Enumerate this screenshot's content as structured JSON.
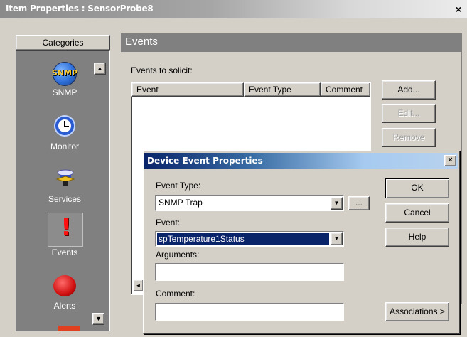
{
  "window": {
    "title": "Item Properties : SensorProbe8",
    "close_glyph": "×"
  },
  "categories": {
    "header": "Categories",
    "items": [
      {
        "label": "SNMP",
        "icon": "snmp-icon",
        "icon_text": "SNMP"
      },
      {
        "label": "Monitor",
        "icon": "monitor-clock-icon"
      },
      {
        "label": "Services",
        "icon": "services-icon"
      },
      {
        "label": "Events",
        "icon": "events-exclamation-icon",
        "selected": true
      },
      {
        "label": "Alerts",
        "icon": "alerts-icon"
      }
    ],
    "scroll_up_glyph": "▲",
    "scroll_down_glyph": "▼"
  },
  "events_panel": {
    "header": "Events",
    "solicit_label": "Events to solicit:",
    "columns": [
      "Event",
      "Event Type",
      "Comment"
    ],
    "buttons": {
      "add": "Add...",
      "edit": "Edit...",
      "remove": "Remove"
    },
    "scroll_left_glyph": "◄"
  },
  "dialog": {
    "title": "Device Event Properties",
    "close_glyph": "×",
    "event_type_label": "Event Type:",
    "event_type_value": "SNMP Trap",
    "browse_label": "...",
    "event_label": "Event:",
    "event_value": "spTemperature1Status",
    "arguments_label": "Arguments:",
    "arguments_value": "",
    "comment_label": "Comment:",
    "comment_value": "",
    "ok_label": "OK",
    "cancel_label": "Cancel",
    "help_label": "Help",
    "associations_label": "Associations >",
    "dropdown_glyph": "▼"
  }
}
